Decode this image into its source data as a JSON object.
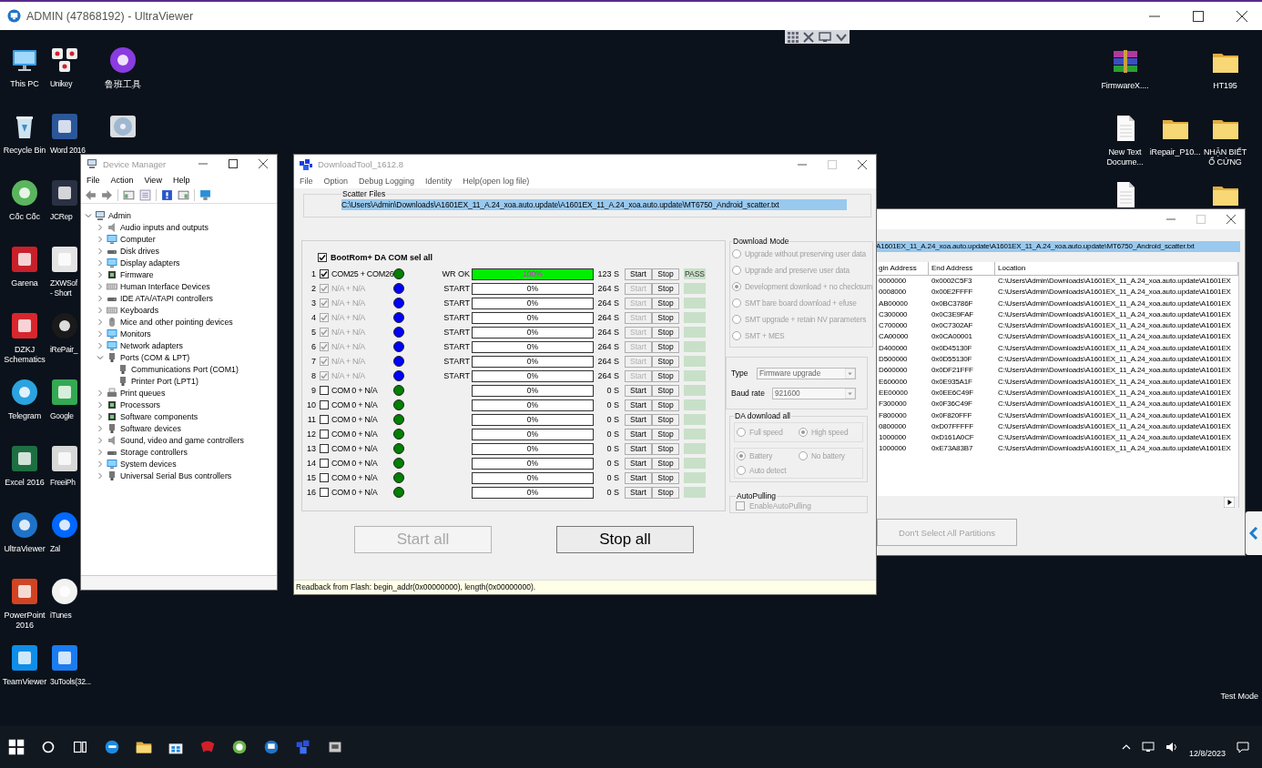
{
  "window": {
    "title": "ADMIN (47868192) - UltraViewer"
  },
  "desktop_left": [
    {
      "kind": "monitor",
      "label": "This PC",
      "color": "#3a9be0"
    },
    {
      "kind": "bin",
      "label": "Recycle Bin"
    },
    {
      "kind": "round",
      "label": "Cốc Cốc",
      "color": "#5ab55e"
    },
    {
      "kind": "tile",
      "label": "Garena",
      "color": "#c8202a"
    },
    {
      "kind": "tile",
      "label": "DZKJ\nSchematics",
      "color": "#d8262e"
    },
    {
      "kind": "round",
      "label": "Telegram",
      "color": "#2aa3e0"
    },
    {
      "kind": "tile",
      "label": "Excel 2016",
      "color": "#1d6f42"
    },
    {
      "kind": "round",
      "label": "UltraViewer",
      "color": "#1e73c8"
    },
    {
      "kind": "tile",
      "label": "PowerPoint\n2016",
      "color": "#d04423"
    },
    {
      "kind": "tile",
      "label": "TeamViewer",
      "color": "#0e8ee9"
    },
    {
      "kind": "keys",
      "label": "Unikey"
    },
    {
      "kind": "tile",
      "label": "Word 2016",
      "color": "#2b579a"
    },
    {
      "kind": "tile",
      "label": "JCRep",
      "color": "#2a3142"
    },
    {
      "kind": "tile",
      "label": "ZXWSof\n- Short",
      "color": "#e4e4e4"
    },
    {
      "kind": "round",
      "label": "iRePair_",
      "color": "#1a1a1a"
    },
    {
      "kind": "tile",
      "label": "Google",
      "color": "#34a853"
    },
    {
      "kind": "tile",
      "label": "FreeiPh",
      "color": "#d8d8d8"
    },
    {
      "kind": "round",
      "label": "Zal",
      "color": "#0068ff"
    },
    {
      "kind": "round",
      "label": "iTunes",
      "color": "#f2f2f2"
    },
    {
      "kind": "tile",
      "label": "3uTools(32...",
      "color": "#1a7cf0"
    },
    {
      "kind": "round",
      "label": "鲁班工具",
      "color": "#8a3ce0"
    },
    {
      "kind": "disc"
    }
  ],
  "desktop_right": [
    {
      "kind": "archive",
      "label": "FirmwareX...."
    },
    {
      "kind": "empty"
    },
    {
      "kind": "folder",
      "label": "HT195"
    },
    {
      "kind": "doc",
      "label": "New Text\nDocume..."
    },
    {
      "kind": "folder",
      "label": "iRepair_P10..."
    },
    {
      "kind": "folder",
      "label": "NHẬN BIẾT\nỔ CỨNG"
    },
    {
      "kind": "doc"
    },
    {
      "kind": "empty"
    },
    {
      "kind": "folder"
    }
  ],
  "device_manager": {
    "title": "Device Manager",
    "menu": [
      "File",
      "Action",
      "View",
      "Help"
    ],
    "tree": [
      {
        "label": "Admin",
        "kind": "computer",
        "expanded": true,
        "children": [
          {
            "label": "Audio inputs and outputs",
            "kind": "speaker",
            "expanded": false
          },
          {
            "label": "Computer",
            "kind": "monitor",
            "expanded": false
          },
          {
            "label": "Disk drives",
            "kind": "drive",
            "expanded": false
          },
          {
            "label": "Display adapters",
            "kind": "monitor",
            "expanded": false
          },
          {
            "label": "Firmware",
            "kind": "chip",
            "expanded": false
          },
          {
            "label": "Human Interface Devices",
            "kind": "keyboard",
            "expanded": false
          },
          {
            "label": "IDE ATA/ATAPI controllers",
            "kind": "drive",
            "expanded": false
          },
          {
            "label": "Keyboards",
            "kind": "keyboard",
            "expanded": false
          },
          {
            "label": "Mice and other pointing devices",
            "kind": "mouse",
            "expanded": false
          },
          {
            "label": "Monitors",
            "kind": "monitor",
            "expanded": false
          },
          {
            "label": "Network adapters",
            "kind": "monitor",
            "expanded": false
          },
          {
            "label": "Ports (COM & LPT)",
            "kind": "plug",
            "expanded": true,
            "children": [
              {
                "label": "Communications Port (COM1)",
                "kind": "plug"
              },
              {
                "label": "Printer Port (LPT1)",
                "kind": "plug"
              }
            ]
          },
          {
            "label": "Print queues",
            "kind": "printer",
            "expanded": false
          },
          {
            "label": "Processors",
            "kind": "chip",
            "expanded": false
          },
          {
            "label": "Software components",
            "kind": "chip",
            "expanded": false
          },
          {
            "label": "Software devices",
            "kind": "plug",
            "expanded": false
          },
          {
            "label": "Sound, video and game controllers",
            "kind": "speaker",
            "expanded": false
          },
          {
            "label": "Storage controllers",
            "kind": "drive",
            "expanded": false
          },
          {
            "label": "System devices",
            "kind": "monitor",
            "expanded": false
          },
          {
            "label": "Universal Serial Bus controllers",
            "kind": "plug",
            "expanded": false
          }
        ]
      }
    ]
  },
  "download_tool": {
    "title": "DownloadTool_1612.8",
    "menu": [
      "File",
      "Option",
      "Debug Logging",
      "Identity",
      "Help(open log file)"
    ],
    "scatter": {
      "legend": "Scatter Files",
      "path": "C:\\Users\\Admin\\Downloads\\A1601EX_11_A.24_xoa.auto.update\\A1601EX_11_A.24_xoa.auto.update\\MT6750_Android_scatter.txt"
    },
    "select_all": {
      "label": "BootRom+ DA COM sel all",
      "checked": true
    },
    "rows": [
      {
        "number": "1",
        "checked": true,
        "disabled": false,
        "port": "COM25 + COM26",
        "color": "#008000",
        "status": "WR OK",
        "level": 1,
        "percent": "100%",
        "time": "123 S",
        "start": "Start",
        "stop": "Stop",
        "result": "PASS"
      },
      {
        "number": "2",
        "checked": true,
        "disabled": true,
        "port": "N/A + N/A",
        "color": "#0000ff",
        "status": "START",
        "level": 0,
        "percent": "0%",
        "time": "264 S",
        "start": "Start",
        "stop": "Stop"
      },
      {
        "number": "3",
        "checked": true,
        "disabled": true,
        "port": "N/A + N/A",
        "color": "#0000ff",
        "status": "START",
        "level": 0,
        "percent": "0%",
        "time": "264 S",
        "start": "Start",
        "stop": "Stop"
      },
      {
        "number": "4",
        "checked": true,
        "disabled": true,
        "port": "N/A + N/A",
        "color": "#0000ff",
        "status": "START",
        "level": 0,
        "percent": "0%",
        "time": "264 S",
        "start": "Start",
        "stop": "Stop"
      },
      {
        "number": "5",
        "checked": true,
        "disabled": true,
        "port": "N/A + N/A",
        "color": "#0000ff",
        "status": "START",
        "level": 0,
        "percent": "0%",
        "time": "264 S",
        "start": "Start",
        "stop": "Stop"
      },
      {
        "number": "6",
        "checked": true,
        "disabled": true,
        "port": "N/A + N/A",
        "color": "#0000ff",
        "status": "START",
        "level": 0,
        "percent": "0%",
        "time": "264 S",
        "start": "Start",
        "stop": "Stop"
      },
      {
        "number": "7",
        "checked": true,
        "disabled": true,
        "port": "N/A + N/A",
        "color": "#0000ff",
        "status": "START",
        "level": 0,
        "percent": "0%",
        "time": "264 S",
        "start": "Start",
        "stop": "Stop"
      },
      {
        "number": "8",
        "checked": true,
        "disabled": true,
        "port": "N/A + N/A",
        "color": "#0000ff",
        "status": "START",
        "level": 0,
        "percent": "0%",
        "time": "264 S",
        "start": "Start",
        "stop": "Stop"
      },
      {
        "number": "9",
        "checked": false,
        "disabled": false,
        "port": "COM 0 + N/A",
        "color": "#008000",
        "level": 0,
        "percent": "0%",
        "time": "0 S",
        "start": "Start",
        "stop": "Stop"
      },
      {
        "number": "10",
        "checked": false,
        "disabled": false,
        "port": "COM 0 + N/A",
        "color": "#008000",
        "level": 0,
        "percent": "0%",
        "time": "0 S",
        "start": "Start",
        "stop": "Stop"
      },
      {
        "number": "11",
        "checked": false,
        "disabled": false,
        "port": "COM 0 + N/A",
        "color": "#008000",
        "level": 0,
        "percent": "0%",
        "time": "0 S",
        "start": "Start",
        "stop": "Stop"
      },
      {
        "number": "12",
        "checked": false,
        "disabled": false,
        "port": "COM 0 + N/A",
        "color": "#008000",
        "level": 0,
        "percent": "0%",
        "time": "0 S",
        "start": "Start",
        "stop": "Stop"
      },
      {
        "number": "13",
        "checked": false,
        "disabled": false,
        "port": "COM 0 + N/A",
        "color": "#008000",
        "level": 0,
        "percent": "0%",
        "time": "0 S",
        "start": "Start",
        "stop": "Stop"
      },
      {
        "number": "14",
        "checked": false,
        "disabled": false,
        "port": "COM 0 + N/A",
        "color": "#008000",
        "level": 0,
        "percent": "0%",
        "time": "0 S",
        "start": "Start",
        "stop": "Stop"
      },
      {
        "number": "15",
        "checked": false,
        "disabled": false,
        "port": "COM 0 + N/A",
        "color": "#008000",
        "level": 0,
        "percent": "0%",
        "time": "0 S",
        "start": "Start",
        "stop": "Stop"
      },
      {
        "number": "16",
        "checked": false,
        "disabled": false,
        "port": "COM 0 + N/A",
        "color": "#008000",
        "level": 0,
        "percent": "0%",
        "time": "0 S",
        "start": "Start",
        "stop": "Stop"
      }
    ],
    "download_mode": {
      "legend": "Download Mode",
      "disabled": true,
      "options": [
        {
          "label": "Upgrade without preserving user data",
          "selected": false
        },
        {
          "label": "Upgrade and preserve user data",
          "selected": false
        },
        {
          "label": "Development download + no checksum",
          "selected": true
        },
        {
          "label": "SMT bare board download + efuse",
          "selected": false
        },
        {
          "label": "SMT upgrade + retain NV parameters",
          "selected": false
        },
        {
          "label": "SMT + MES",
          "selected": false
        }
      ]
    },
    "type": {
      "label": "Type",
      "value": "Firmware upgrade",
      "disabled": true
    },
    "baud_rate": {
      "label": "Baud rate",
      "value": "921600",
      "disabled": true
    },
    "da_download": {
      "legend": "DA download all",
      "disabled": true,
      "speed": [
        {
          "label": "Full speed",
          "selected": false
        },
        {
          "label": "High speed",
          "selected": true
        }
      ],
      "battery": [
        {
          "label": "Battery",
          "selected": true
        },
        {
          "label": "No battery",
          "selected": false
        },
        {
          "label": "Auto detect",
          "selected": false
        }
      ]
    },
    "auto_pulling": {
      "legend": "AutoPulling",
      "label": "EnableAutoPulling",
      "checked": false,
      "disabled": true
    },
    "start_all": {
      "label": "Start all",
      "disabled": true
    },
    "stop_all": {
      "label": "Stop all",
      "disabled": false
    },
    "status_bar": "Readback from Flash:  begin_addr(0x00000000), length(0x00000000)."
  },
  "partition_window": {
    "path": "A1601EX_11_A.24_xoa.auto.update\\A1601EX_11_A.24_xoa.auto.update\\MT6750_Android_scatter.txt",
    "columns": [
      "gin Address",
      "End Address",
      "Location"
    ],
    "rows": [
      [
        "0000000",
        "0x0002C5F3",
        "C:\\Users\\Admin\\Downloads\\A1601EX_11_A.24_xoa.auto.update\\A1601EX"
      ],
      [
        "0008000",
        "0x00E2FFFF",
        "C:\\Users\\Admin\\Downloads\\A1601EX_11_A.24_xoa.auto.update\\A1601EX"
      ],
      [
        "AB00000",
        "0x0BC3786F",
        "C:\\Users\\Admin\\Downloads\\A1601EX_11_A.24_xoa.auto.update\\A1601EX"
      ],
      [
        "C300000",
        "0x0C3E9FAF",
        "C:\\Users\\Admin\\Downloads\\A1601EX_11_A.24_xoa.auto.update\\A1601EX"
      ],
      [
        "C700000",
        "0x0C7302AF",
        "C:\\Users\\Admin\\Downloads\\A1601EX_11_A.24_xoa.auto.update\\A1601EX"
      ],
      [
        "CA00000",
        "0x0CA00001",
        "C:\\Users\\Admin\\Downloads\\A1601EX_11_A.24_xoa.auto.update\\A1601EX"
      ],
      [
        "D400000",
        "0x0D45130F",
        "C:\\Users\\Admin\\Downloads\\A1601EX_11_A.24_xoa.auto.update\\A1601EX"
      ],
      [
        "D500000",
        "0x0D55130F",
        "C:\\Users\\Admin\\Downloads\\A1601EX_11_A.24_xoa.auto.update\\A1601EX"
      ],
      [
        "D600000",
        "0x0DF21FFF",
        "C:\\Users\\Admin\\Downloads\\A1601EX_11_A.24_xoa.auto.update\\A1601EX"
      ],
      [
        "E600000",
        "0x0E935A1F",
        "C:\\Users\\Admin\\Downloads\\A1601EX_11_A.24_xoa.auto.update\\A1601EX"
      ],
      [
        "EE00000",
        "0x0EE6C49F",
        "C:\\Users\\Admin\\Downloads\\A1601EX_11_A.24_xoa.auto.update\\A1601EX"
      ],
      [
        "F300000",
        "0x0F36C49F",
        "C:\\Users\\Admin\\Downloads\\A1601EX_11_A.24_xoa.auto.update\\A1601EX"
      ],
      [
        "F800000",
        "0x0F820FFF",
        "C:\\Users\\Admin\\Downloads\\A1601EX_11_A.24_xoa.auto.update\\A1601EX"
      ],
      [
        "0800000",
        "0xD07FFFFF",
        "C:\\Users\\Admin\\Downloads\\A1601EX_11_A.24_xoa.auto.update\\A1601EX"
      ],
      [
        "1000000",
        "0xD161A0CF",
        "C:\\Users\\Admin\\Downloads\\A1601EX_11_A.24_xoa.auto.update\\A1601EX"
      ],
      [
        "1000000",
        "0xE73A83B7",
        "C:\\Users\\Admin\\Downloads\\A1601EX_11_A.24_xoa.auto.update\\A1601EX"
      ]
    ],
    "button": {
      "label": "Don't Select All Partitions",
      "disabled": true
    }
  },
  "system_note": "Test Mode",
  "taskbar": {
    "apps": [
      {
        "kind": "start"
      },
      {
        "kind": "search"
      },
      {
        "kind": "taskview"
      },
      {
        "kind": "edge"
      },
      {
        "kind": "explorer"
      },
      {
        "kind": "store"
      },
      {
        "kind": "garena"
      },
      {
        "kind": "coccoc"
      },
      {
        "kind": "ultraviewer"
      },
      {
        "kind": "downloadtool"
      },
      {
        "kind": "flashtool"
      }
    ],
    "date": "12/8/2023"
  }
}
